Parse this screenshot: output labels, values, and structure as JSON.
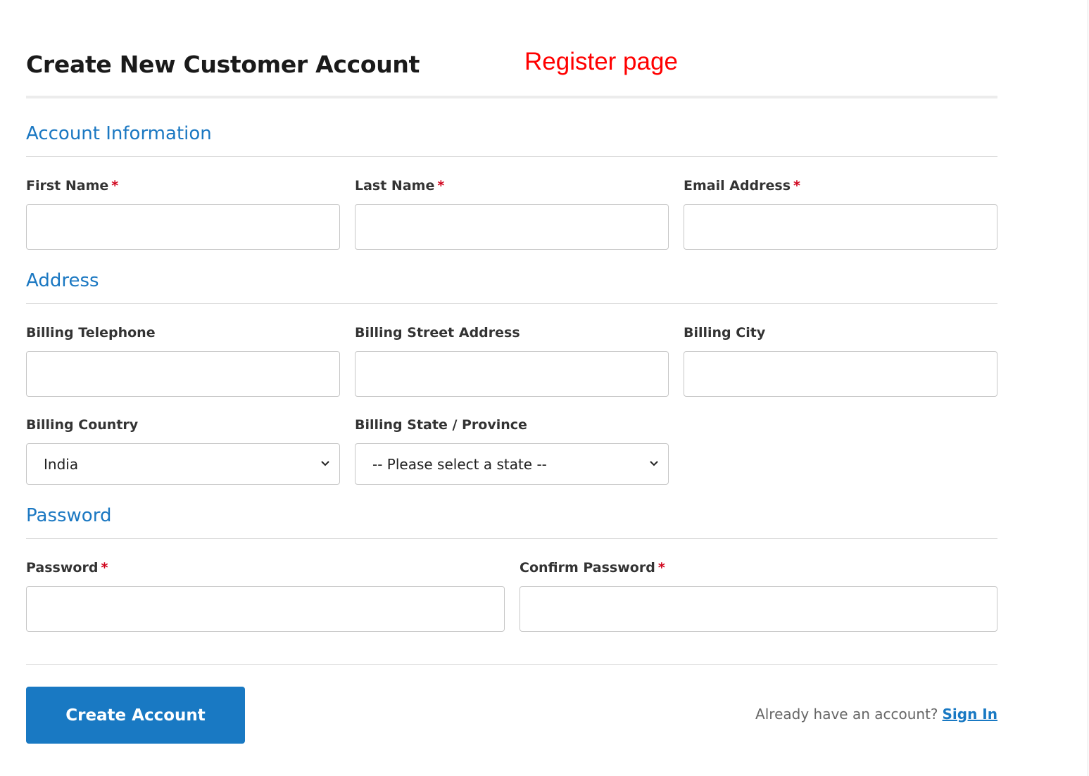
{
  "page": {
    "title": "Create New Customer Account",
    "annotation": "Register page"
  },
  "sections": {
    "account": {
      "title": "Account Information",
      "fields": {
        "first_name": {
          "label": "First Name",
          "required_mark": "*",
          "value": ""
        },
        "last_name": {
          "label": "Last Name",
          "required_mark": "*",
          "value": ""
        },
        "email": {
          "label": "Email Address",
          "required_mark": "*",
          "value": ""
        }
      }
    },
    "address": {
      "title": "Address",
      "fields": {
        "telephone": {
          "label": "Billing Telephone",
          "value": ""
        },
        "street": {
          "label": "Billing Street Address",
          "value": ""
        },
        "city": {
          "label": "Billing City",
          "value": ""
        },
        "country": {
          "label": "Billing Country",
          "selected": "India"
        },
        "state": {
          "label": "Billing State / Province",
          "selected": "-- Please select a state --"
        }
      }
    },
    "password": {
      "title": "Password",
      "fields": {
        "password": {
          "label": "Password",
          "required_mark": "*",
          "value": ""
        },
        "confirm": {
          "label": "Confirm Password",
          "required_mark": "*",
          "value": ""
        }
      }
    }
  },
  "actions": {
    "submit_label": "Create Account",
    "signin_prompt": "Already have an account?",
    "signin_link": "Sign In"
  },
  "colors": {
    "accent": "#1979c3",
    "required": "#d0021b",
    "annotation": "#ff0000"
  }
}
